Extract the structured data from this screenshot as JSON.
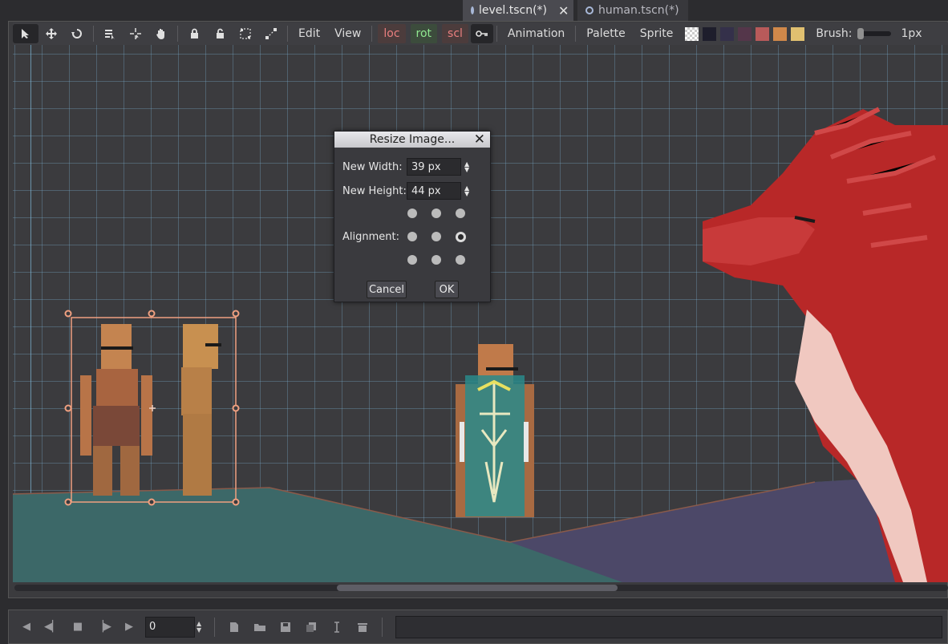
{
  "tabs": [
    {
      "label": "level.tscn(*)",
      "close": "✕"
    },
    {
      "label": "human.tscn(*)"
    }
  ],
  "toolbar": {
    "menus": {
      "edit": "Edit",
      "view": "View",
      "animation": "Animation",
      "palette": "Palette",
      "sprite": "Sprite"
    },
    "toggles": {
      "loc": "loc",
      "rot": "rot",
      "scl": "scl"
    },
    "brush_label": "Brush:",
    "brush_size": "1px",
    "swatches": [
      "#2a2a3a",
      "#3a3348",
      "#5a3a48",
      "#b85a5a",
      "#d0884a",
      "#e0c070"
    ]
  },
  "dialog": {
    "title": "Resize Image...",
    "close": "✕",
    "width_label": "New Width:",
    "width_value": "39 px",
    "height_label": "New Height:",
    "height_value": "44 px",
    "alignment_label": "Alignment:",
    "alignment_selected": "middle-right",
    "cancel": "Cancel",
    "ok": "OK"
  },
  "animation_panel": {
    "frame_value": "0"
  },
  "colors": {
    "accent_selection": "#f0a080",
    "ground": "#3d6a6a",
    "dragon_red": "#b82828"
  }
}
